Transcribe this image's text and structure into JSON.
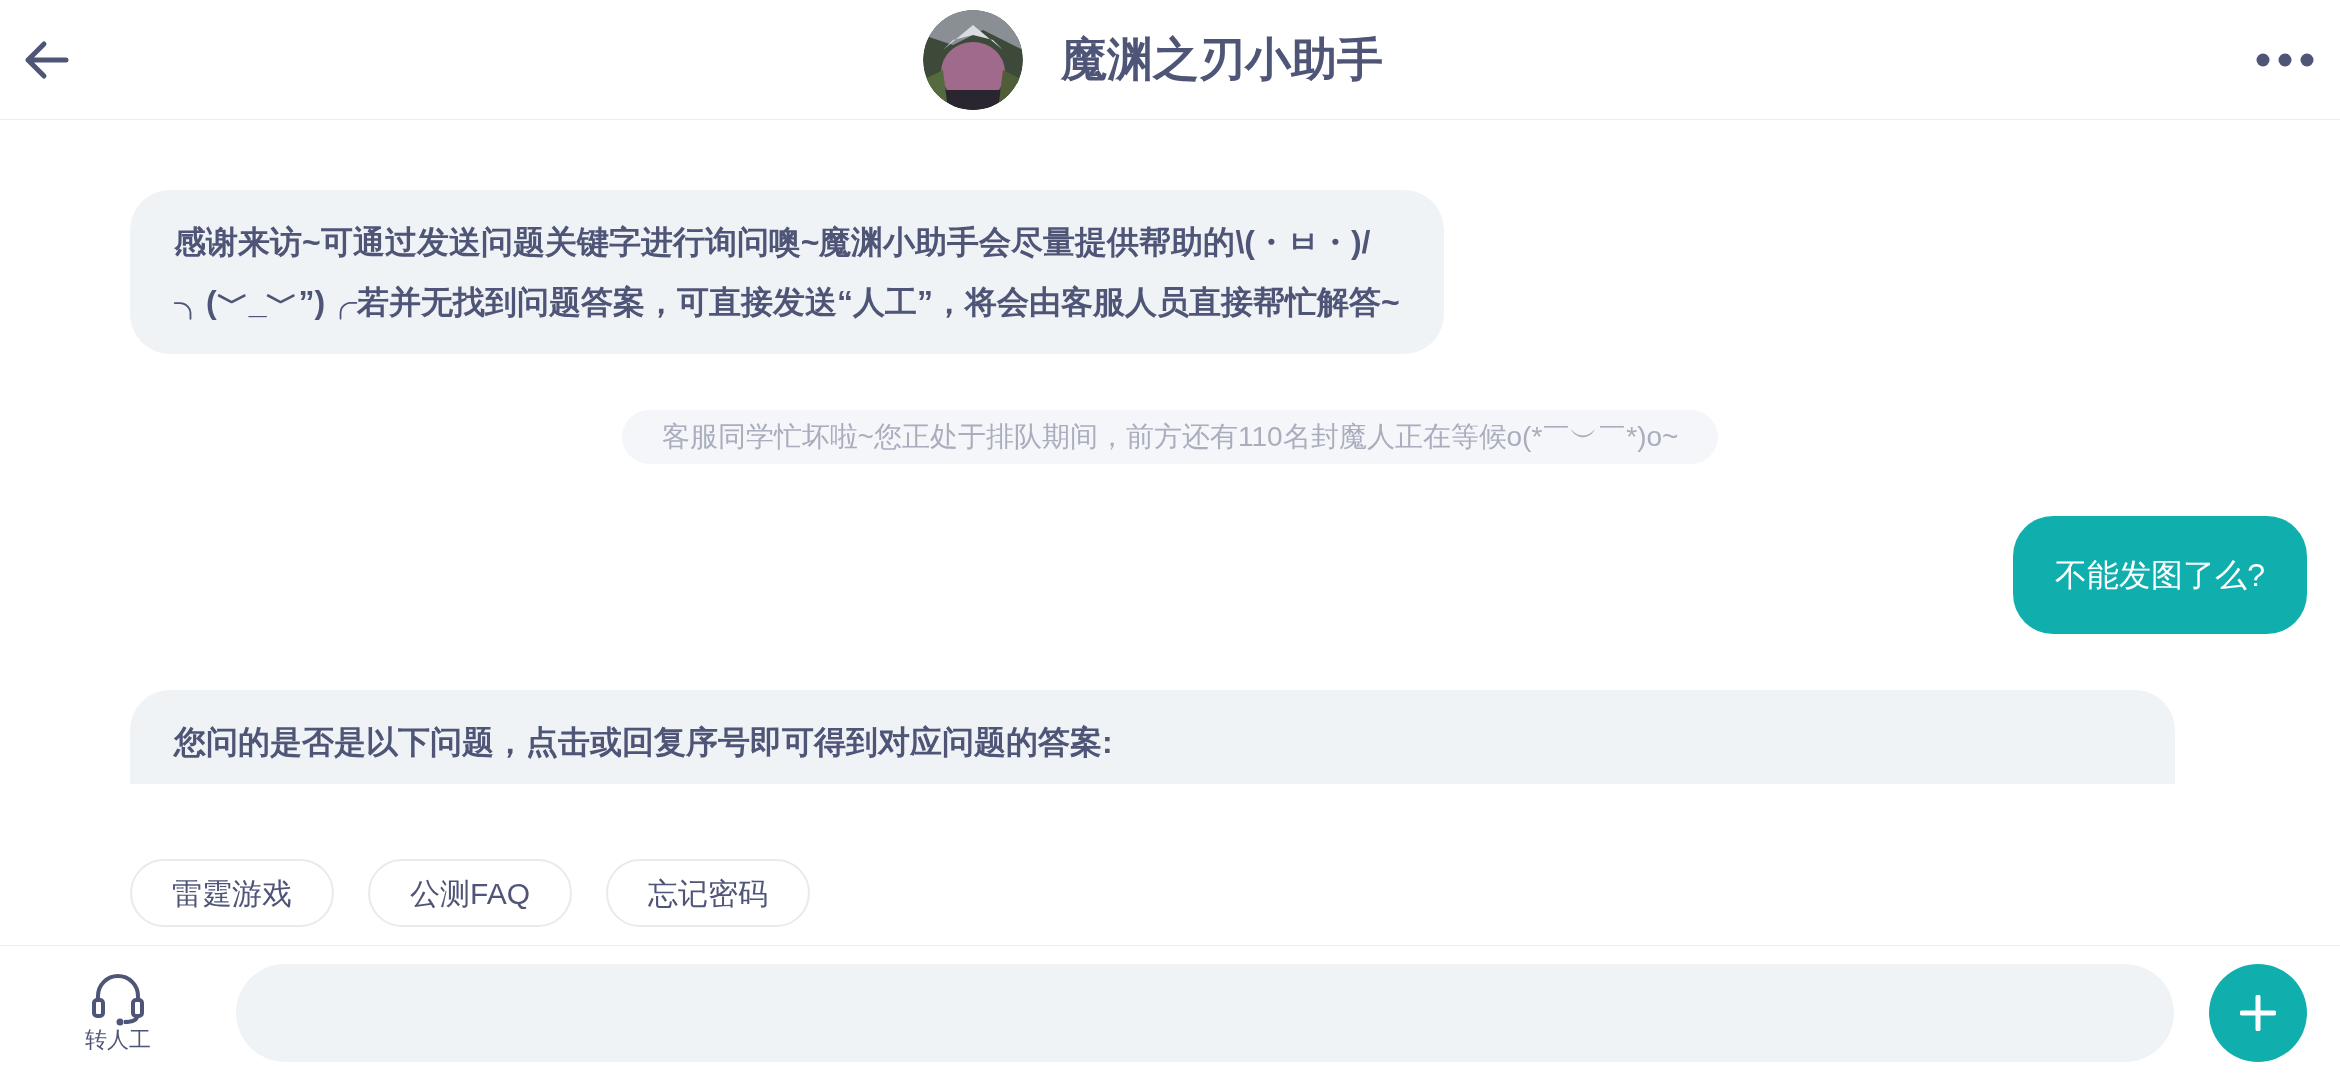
{
  "header": {
    "title": "魔渊之刃小助手"
  },
  "messages": [
    {
      "kind": "bot",
      "lines": [
        "感谢来访~可通过发送问题关键字进行询问噢~魔渊小助手会尽量提供帮助的\\(・ㅂ・)/",
        "╮(﹀_﹀”)╭若并无找到问题答案，可直接发送“人工”，将会由客服人员直接帮忙解答~"
      ]
    },
    {
      "kind": "system",
      "lines": [
        "客服同学忙坏啦~您正处于排队期间，前方还有110名封魔人正在等候o(*￣︶￣*)o~"
      ]
    },
    {
      "kind": "user",
      "lines": [
        "不能发图了么?"
      ]
    },
    {
      "kind": "bot_cut",
      "lines": [
        "您问的是否是以下问题，点击或回复序号即可得到对应问题的答案:"
      ]
    }
  ],
  "quick_replies": [
    "雷霆游戏",
    "公测FAQ",
    "忘记密码"
  ],
  "bottom_bar": {
    "transfer_label": "转人工"
  }
}
